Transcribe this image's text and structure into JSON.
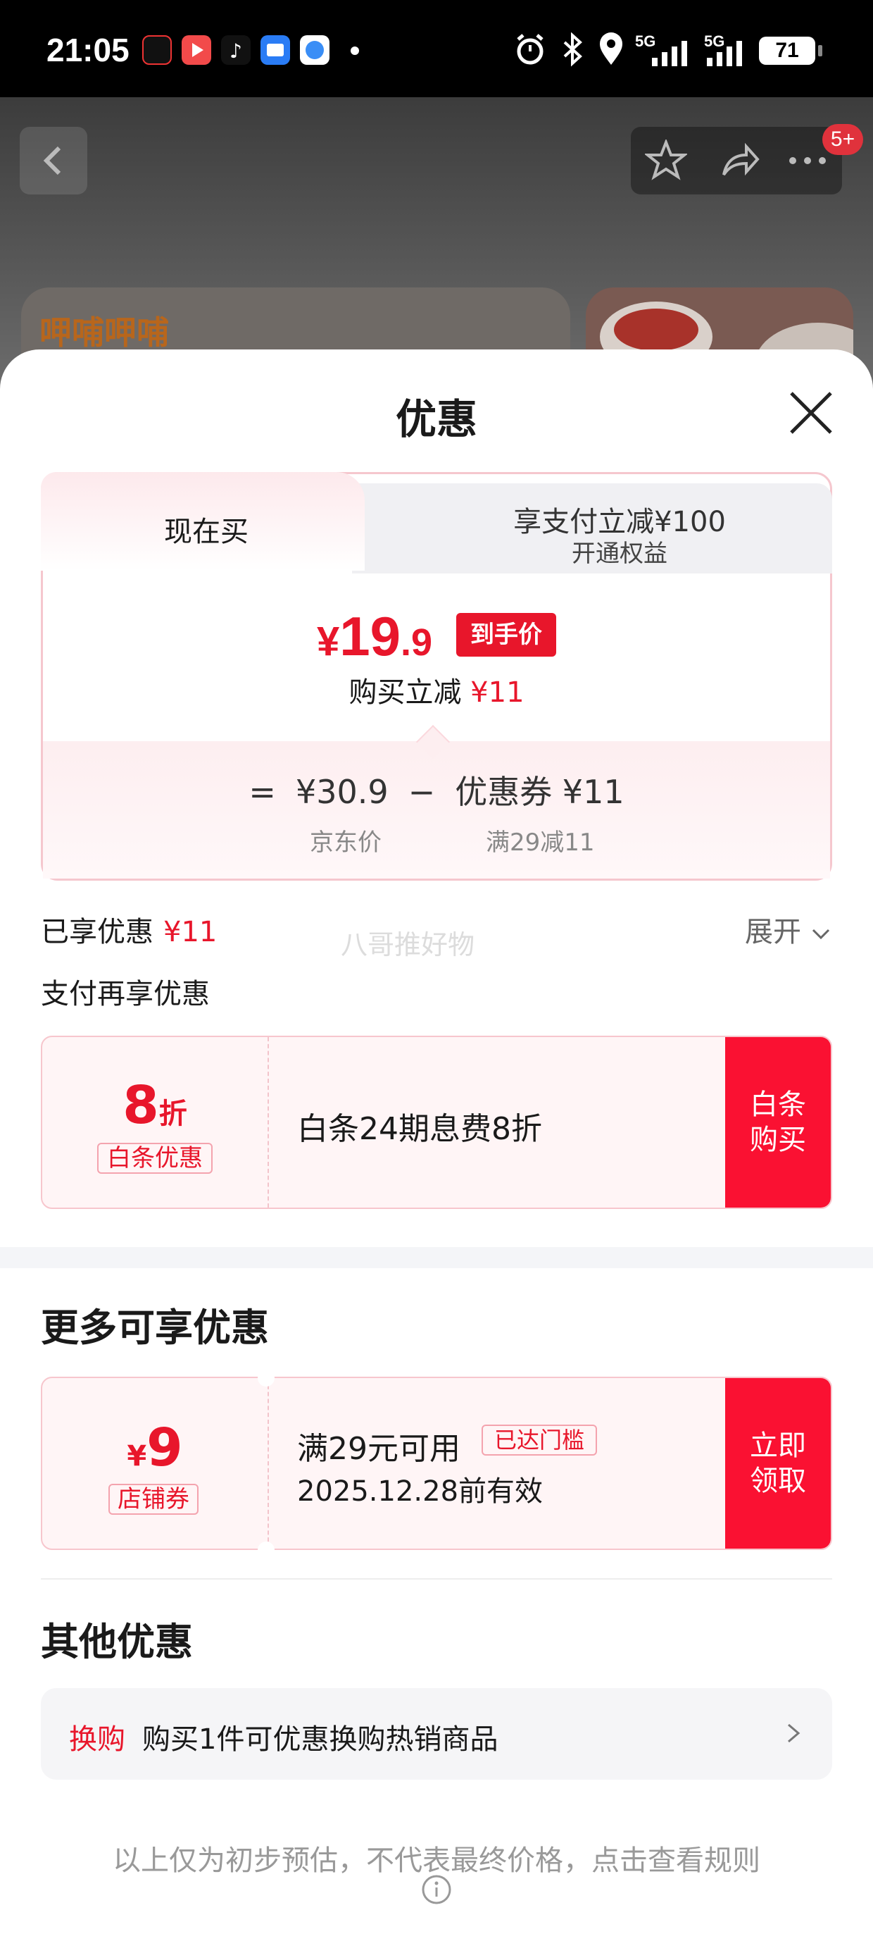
{
  "status_bar": {
    "time": "21:05",
    "signal_label_1": "5G",
    "signal_label_2": "5G",
    "battery": "71",
    "icons": [
      "douyin-lite-icon",
      "video-app-icon",
      "tiktok-icon",
      "files-app-icon",
      "browser-app-icon",
      "dot-icon",
      "alarm-icon",
      "bluetooth-icon",
      "location-icon",
      "signal-icon",
      "battery-icon"
    ]
  },
  "background": {
    "brand_logo": "呷哺呷哺",
    "notification_badge": "5+"
  },
  "sheet": {
    "title": "优惠"
  },
  "tabs": {
    "now": "现在买",
    "pay_reduce": "享支付立减¥100",
    "pay_reduce_sub": "开通权益"
  },
  "price": {
    "currency": "¥",
    "integer": "19",
    "decimal": ".9",
    "tag": "到手价",
    "reduce_label": "购买立减",
    "reduce_value": "¥11"
  },
  "breakdown": {
    "equals": "=",
    "jd_price": "¥30.9",
    "minus": "−",
    "coupon": "优惠券 ¥11",
    "jd_label": "京东价",
    "coupon_label": "满29减11"
  },
  "enjoyed": {
    "label": "已享优惠",
    "value": "¥11",
    "expand": "展开"
  },
  "watermark": "八哥推好物",
  "pay_more": "支付再享优惠",
  "baitiao_coupon": {
    "big_number": "8",
    "big_unit": "折",
    "chip": "白条优惠",
    "description": "白条24期息费8折",
    "button": "白条\n购买"
  },
  "more_section": {
    "title": "更多可享优惠"
  },
  "store_coupon": {
    "currency": "¥",
    "big_number": "9",
    "chip": "店铺券",
    "condition": "满29元可用",
    "status_chip": "已达门槛",
    "expiry": "2025.12.28前有效",
    "button": "立即\n领取"
  },
  "other_section": {
    "title": "其他优惠",
    "swap_tag": "换购",
    "swap_text": "购买1件可优惠换购热销商品"
  },
  "disclaimer": "以上仅为初步预估，不代表最终价格，点击查看规则",
  "colors": {
    "accent_red": "#e8162b",
    "button_red": "#fa1132",
    "coupon_bg": "#fff5f6"
  }
}
